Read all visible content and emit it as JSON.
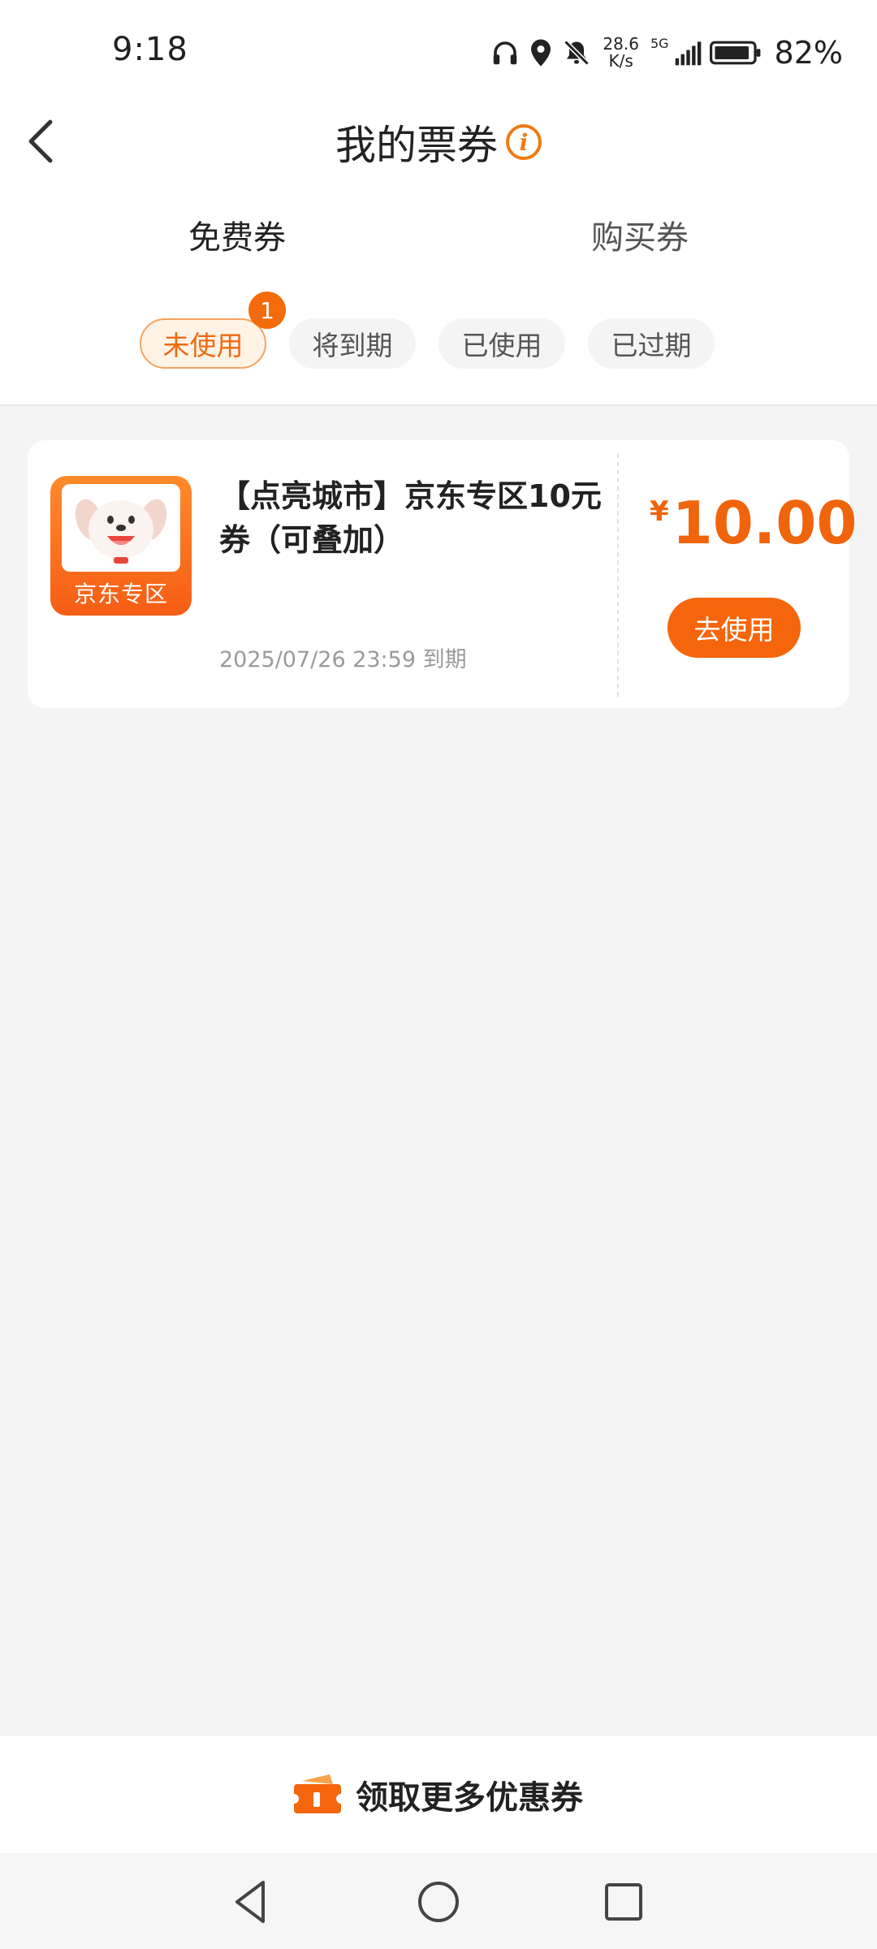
{
  "status_bar": {
    "time": "9:18",
    "net_speed_value": "28.6",
    "net_speed_unit": "K/s",
    "network_type": "5G",
    "battery": "82%",
    "icons": [
      "headphones-icon",
      "location-icon",
      "bell-muted-icon",
      "signal-icon",
      "battery-icon"
    ]
  },
  "header": {
    "title": "我的票券",
    "info_icon_glyph": "i"
  },
  "tabs": [
    {
      "label": "免费券",
      "active": true
    },
    {
      "label": "购买券",
      "active": false
    }
  ],
  "filters": {
    "items": [
      {
        "label": "未使用",
        "active": true
      },
      {
        "label": "将到期",
        "active": false
      },
      {
        "label": "已使用",
        "active": false
      },
      {
        "label": "已过期",
        "active": false
      }
    ],
    "badge": "1"
  },
  "coupons": [
    {
      "title": "【点亮城市】京东专区10元券（可叠加）",
      "logo_text": "京东专区",
      "expiry": "2025/07/26 23:59 到期",
      "currency_symbol": "¥",
      "amount": "10.00",
      "action_label": "去使用"
    }
  ],
  "bottom_bar": {
    "label": "领取更多优惠券"
  },
  "colors": {
    "accent": "#f5650c",
    "background": "#f4f4f4",
    "chip_active_bg": "#fff3e6"
  }
}
